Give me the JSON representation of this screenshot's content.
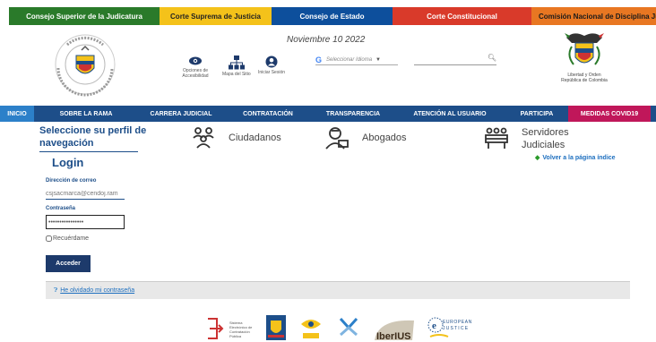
{
  "top_links": [
    "Consejo Superior de la Judicatura",
    "Corte Suprema de Justicia",
    "Consejo de Estado",
    "Corte Constitucional",
    "Comisión Nacional de Disciplina Judicial"
  ],
  "header": {
    "date": "Noviembre 10 2022",
    "accesibilidad_label": "Opciones de Accesibilidad",
    "mapa_label": "Mapa del Sitio",
    "login_label": "Iniciar Sesión",
    "language_placeholder": "Seleccionar Idioma",
    "language_arrow": "▼",
    "shield_label": "Libertad y Orden República de Colombia"
  },
  "nav": [
    "INICIO",
    "SOBRE LA RAMA",
    "CARRERA JUDICIAL",
    "CONTRATACIÓN",
    "TRANSPARENCIA",
    "ATENCIÓN AL USUARIO",
    "PARTICIPA",
    "MEDIDAS COVID19"
  ],
  "profile": {
    "title": "Seleccione su perfil de navegación",
    "ciudadanos": "Ciudadanos",
    "abogados": "Abogados",
    "servidores": "Servidores Judiciales"
  },
  "login": {
    "title": "Login",
    "back_link": "Volver a la página índice",
    "email_label": "Dirección de correo",
    "email_value": "csjsacmarca@cendoj.ram",
    "password_label": "Contraseña",
    "password_value": "••••••••••••••••",
    "remember_label": "Recuérdame",
    "submit": "Acceder",
    "forgot": "He olvidado mi contraseña"
  },
  "footer_logos": {
    "secop": "Sistema Electrónico de Contratación Pública",
    "iberius": "IberIUS",
    "european": "EUROPEAN JUSTICE"
  },
  "colors": {
    "nav_bg": "#1d4e89",
    "inicio_bg": "#2c80c9",
    "covid_bg": "#c0175a",
    "button_bg": "#1d3a6b"
  }
}
